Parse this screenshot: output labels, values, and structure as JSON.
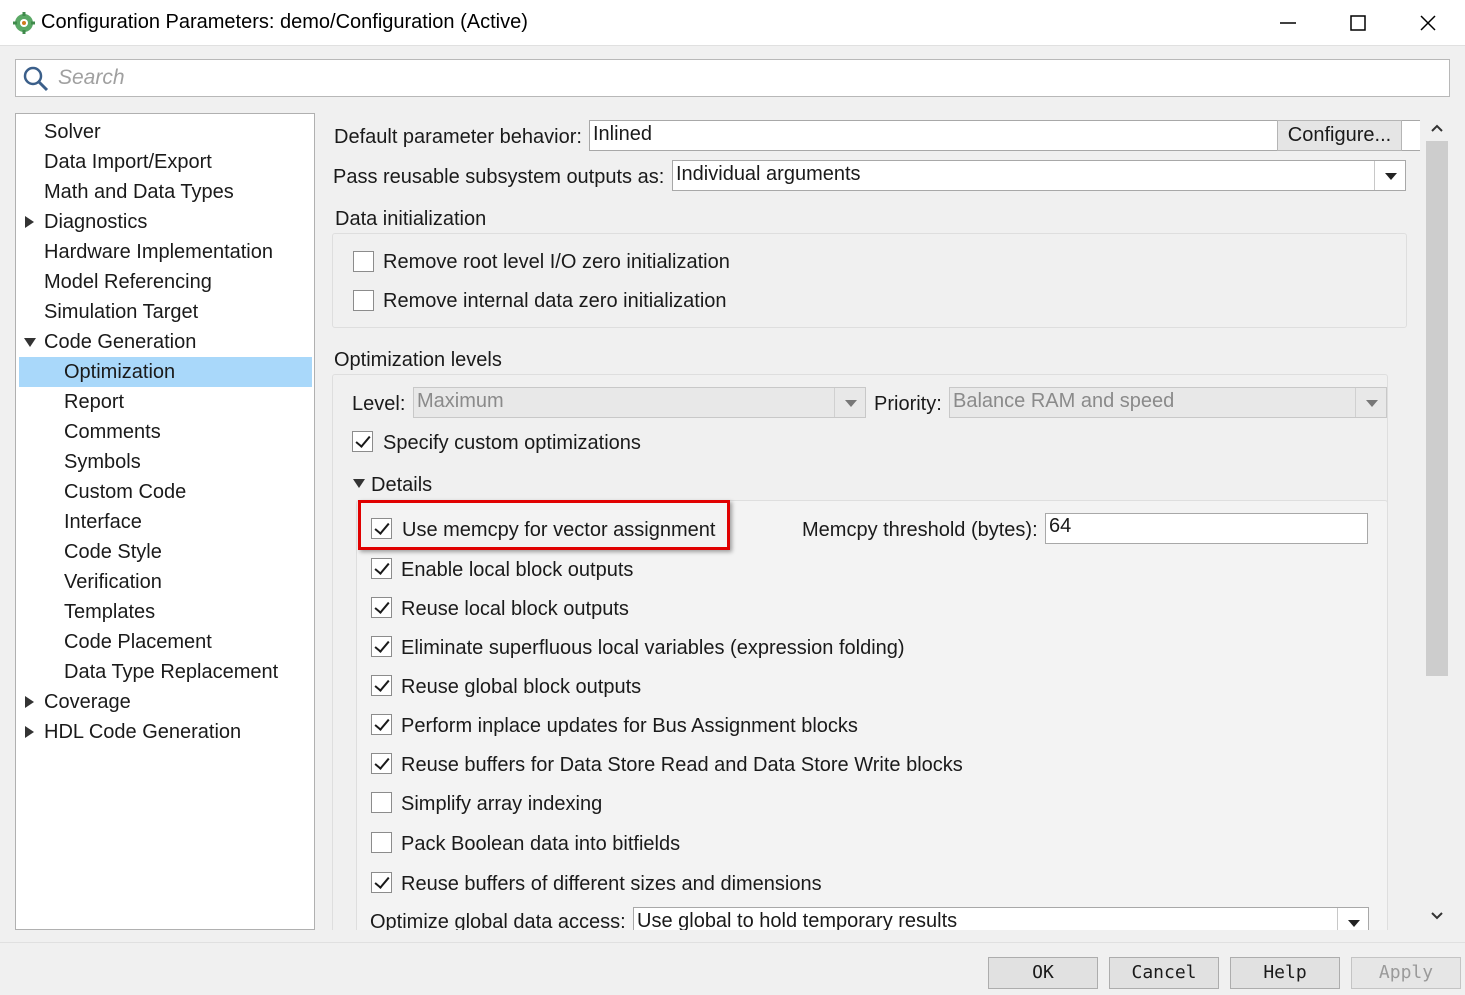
{
  "window": {
    "title": "Configuration Parameters: demo/Configuration (Active)"
  },
  "search": {
    "placeholder": "Search"
  },
  "tree": {
    "items": [
      {
        "label": "Solver",
        "expander": "none"
      },
      {
        "label": "Data Import/Export",
        "expander": "none"
      },
      {
        "label": "Math and Data Types",
        "expander": "none"
      },
      {
        "label": "Diagnostics",
        "expander": "collapsed"
      },
      {
        "label": "Hardware Implementation",
        "expander": "none"
      },
      {
        "label": "Model Referencing",
        "expander": "none"
      },
      {
        "label": "Simulation Target",
        "expander": "none"
      },
      {
        "label": "Code Generation",
        "expander": "expanded"
      },
      {
        "label": "Optimization",
        "expander": "child",
        "selected": true
      },
      {
        "label": "Report",
        "expander": "child"
      },
      {
        "label": "Comments",
        "expander": "child"
      },
      {
        "label": "Symbols",
        "expander": "child"
      },
      {
        "label": "Custom Code",
        "expander": "child"
      },
      {
        "label": "Interface",
        "expander": "child"
      },
      {
        "label": "Code Style",
        "expander": "child"
      },
      {
        "label": "Verification",
        "expander": "child"
      },
      {
        "label": "Templates",
        "expander": "child"
      },
      {
        "label": "Code Placement",
        "expander": "child"
      },
      {
        "label": "Data Type Replacement",
        "expander": "child"
      },
      {
        "label": "Coverage",
        "expander": "collapsed"
      },
      {
        "label": "HDL Code Generation",
        "expander": "collapsed"
      }
    ]
  },
  "main": {
    "default_param_label": "Default parameter behavior:",
    "default_param_value": "Inlined",
    "configure_label": "Configure...",
    "pass_reusable_label": "Pass reusable subsystem outputs as:",
    "pass_reusable_value": "Individual arguments",
    "data_init": {
      "title": "Data initialization",
      "options": [
        {
          "label": "Remove root level I/O zero initialization",
          "checked": false
        },
        {
          "label": "Remove internal data zero initialization",
          "checked": false
        }
      ]
    },
    "opt_levels": {
      "title": "Optimization levels",
      "level_label": "Level:",
      "level_value": "Maximum",
      "priority_label": "Priority:",
      "priority_value": "Balance RAM and speed",
      "custom_opt_label": "Specify custom optimizations",
      "custom_opt_checked": true,
      "details_label": "Details",
      "memcpy_threshold_label": "Memcpy threshold (bytes):",
      "memcpy_threshold_value": "64",
      "details": [
        {
          "label": "Use memcpy for vector assignment",
          "checked": true,
          "highlighted": true
        },
        {
          "label": "Enable local block outputs",
          "checked": true
        },
        {
          "label": "Reuse local block outputs",
          "checked": true
        },
        {
          "label": "Eliminate superfluous local variables (expression folding)",
          "checked": true
        },
        {
          "label": "Reuse global block outputs",
          "checked": true
        },
        {
          "label": "Perform inplace updates for Bus Assignment blocks",
          "checked": true
        },
        {
          "label": "Reuse buffers for Data Store Read and Data Store Write blocks",
          "checked": true
        },
        {
          "label": "Simplify array indexing",
          "checked": false
        },
        {
          "label": "Pack Boolean data into bitfields",
          "checked": false
        },
        {
          "label": "Reuse buffers of different sizes and dimensions",
          "checked": true
        }
      ],
      "global_access_label": "Optimize global data access:",
      "global_access_value": "Use global to hold temporary results"
    }
  },
  "footer": {
    "ok": "OK",
    "cancel": "Cancel",
    "help": "Help",
    "apply": "Apply"
  },
  "colors": {
    "selection": "#a9d8fa",
    "highlight_border": "#e00000"
  }
}
